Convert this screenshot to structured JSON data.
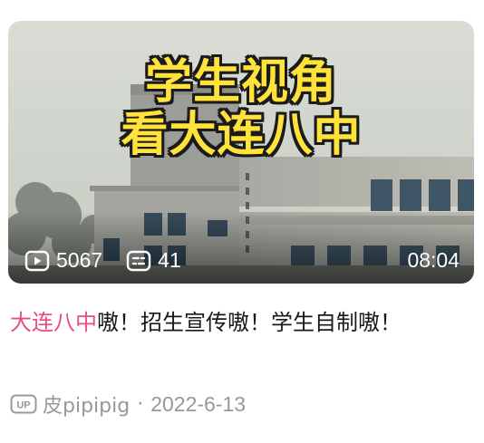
{
  "video": {
    "thumbnail_caption": [
      "学生视角",
      "看大连八中"
    ],
    "views": "5067",
    "comments": "41",
    "duration": "08:04"
  },
  "title": {
    "keyword": "大连八中",
    "rest": "嗷！招生宣传嗷！学生自制嗷！"
  },
  "meta": {
    "up_badge": "UP",
    "author": "皮pipipig",
    "separator": "·",
    "date": "2022-6-13"
  },
  "colors": {
    "keyword": "#e84b85",
    "caption_fill": "#ffe23a",
    "meta_text": "#9499a0"
  },
  "icons": [
    "play-count-icon",
    "danmaku-icon",
    "up-badge-icon"
  ]
}
